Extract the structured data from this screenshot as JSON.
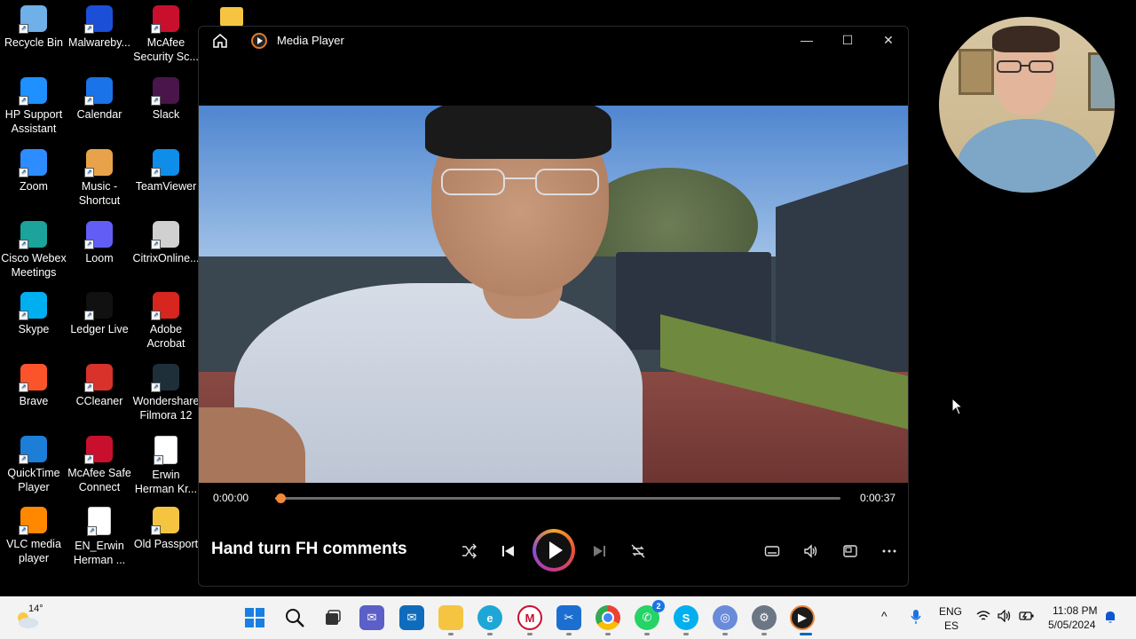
{
  "desktop": {
    "icons": [
      {
        "label": "Recycle Bin",
        "icon": "recycle-bin-icon",
        "color": "#6fb0e8"
      },
      {
        "label": "Malwareby...",
        "icon": "malwarebytes-icon",
        "color": "#1b4fd8"
      },
      {
        "label": "McAfee Security Sc...",
        "icon": "mcafee-icon",
        "color": "#c8102e"
      },
      {
        "label": "HP Support Assistant",
        "icon": "hp-support-icon",
        "color": "#1e90ff"
      },
      {
        "label": "Calendar",
        "icon": "calendar-icon",
        "color": "#1a73e8"
      },
      {
        "label": "Slack",
        "icon": "slack-icon",
        "color": "#4a154b"
      },
      {
        "label": "Zoom",
        "icon": "zoom-icon",
        "color": "#2d8cff"
      },
      {
        "label": "Music - Shortcut",
        "icon": "music-folder-icon",
        "color": "#e8a34a"
      },
      {
        "label": "TeamViewer",
        "icon": "teamviewer-icon",
        "color": "#0e8ee9"
      },
      {
        "label": "Cisco Webex Meetings",
        "icon": "webex-icon",
        "color": "#1ba39c"
      },
      {
        "label": "Loom",
        "icon": "loom-icon",
        "color": "#625df5"
      },
      {
        "label": "CitrixOnline...",
        "icon": "citrix-icon",
        "color": "#d0d0d0"
      },
      {
        "label": "Skype",
        "icon": "skype-icon",
        "color": "#00aff0"
      },
      {
        "label": "Ledger Live",
        "icon": "ledger-icon",
        "color": "#111111"
      },
      {
        "label": "Adobe Acrobat",
        "icon": "acrobat-icon",
        "color": "#d7261e"
      },
      {
        "label": "Brave",
        "icon": "brave-icon",
        "color": "#fb542b"
      },
      {
        "label": "CCleaner",
        "icon": "ccleaner-icon",
        "color": "#d8322a"
      },
      {
        "label": "Wondershare Filmora 12",
        "icon": "filmora-icon",
        "color": "#1f2f3a"
      },
      {
        "label": "QuickTime Player",
        "icon": "quicktime-icon",
        "color": "#1c7ed6"
      },
      {
        "label": "McAfee Safe Connect",
        "icon": "mcafee-safe-connect-icon",
        "color": "#c8102e"
      },
      {
        "label": "Erwin Herman Kr...",
        "icon": "pdf-file-icon",
        "color": "#ffffff"
      },
      {
        "label": "VLC media player",
        "icon": "vlc-icon",
        "color": "#ff8800"
      },
      {
        "label": "EN_Erwin Herman ...",
        "icon": "pdf-file-icon",
        "color": "#ffffff"
      },
      {
        "label": "Old Passport",
        "icon": "folder-icon",
        "color": "#f5c542"
      }
    ]
  },
  "window": {
    "title": "Media Player",
    "minimize": "—",
    "maximize": "☐",
    "close": "✕"
  },
  "player": {
    "current_time": "0:00:00",
    "total_time": "0:00:37",
    "progress": 0.01,
    "media_title": "Hand turn FH comments",
    "accent": "#f08a3a"
  },
  "taskbar": {
    "weather_temp": "14°",
    "whatsapp_badge": "2",
    "lang_top": "ENG",
    "lang_bottom": "ES",
    "time": "11:08 PM",
    "date": "5/05/2024"
  }
}
